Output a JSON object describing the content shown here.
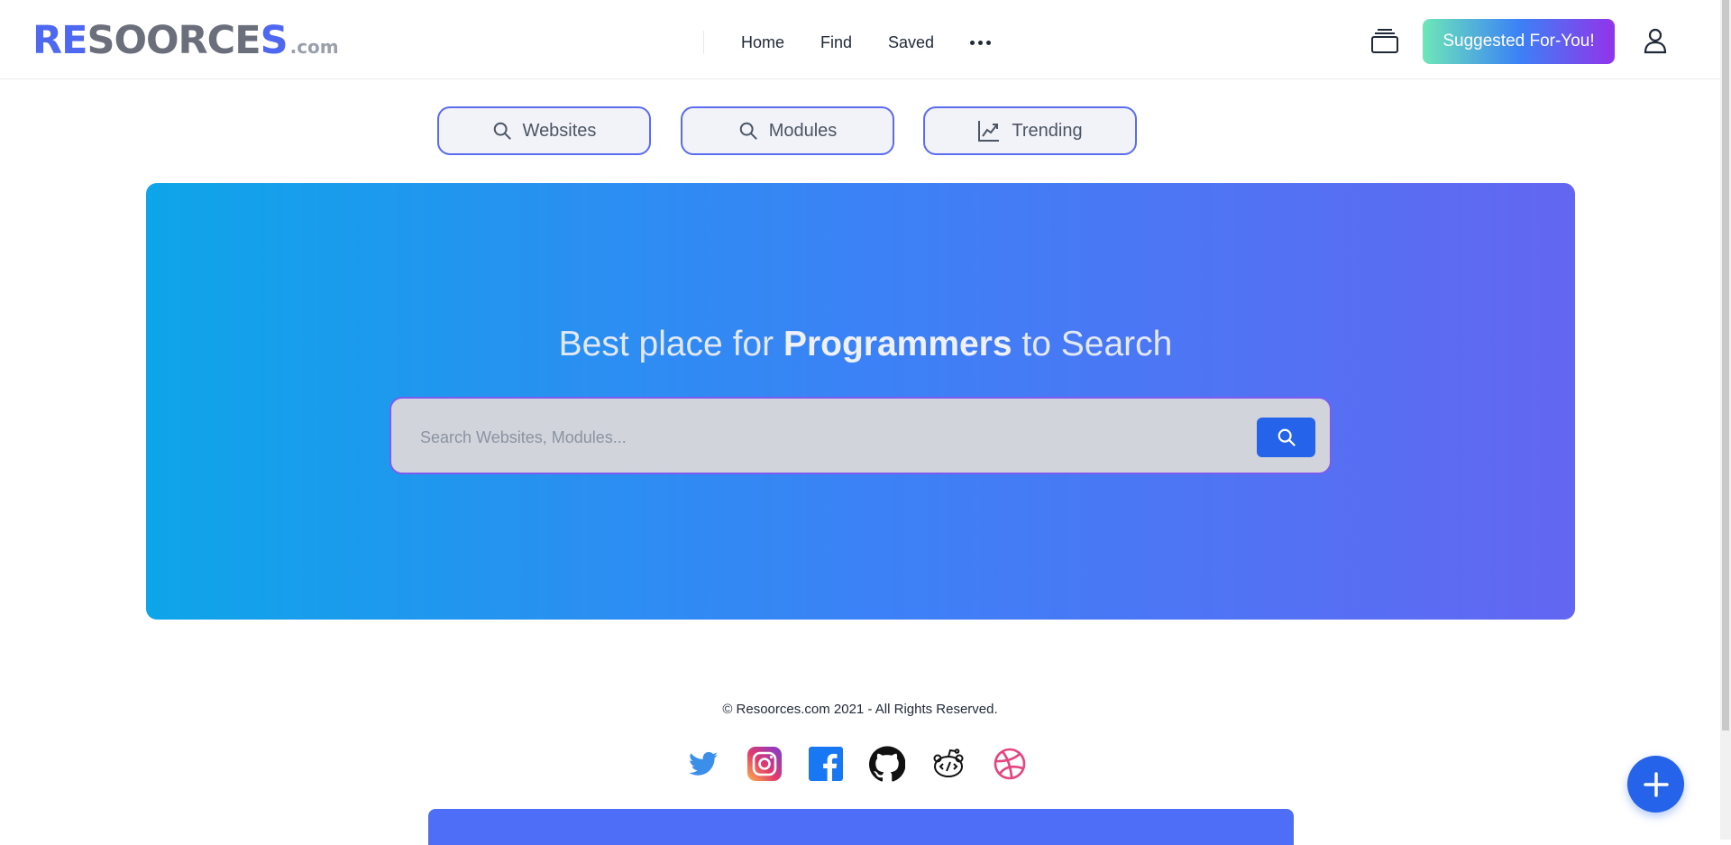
{
  "header": {
    "logo": {
      "part1": "RE",
      "part2": "SOORCE",
      "part3": "S",
      "tld": ".com"
    },
    "nav": {
      "home": "Home",
      "find": "Find",
      "saved": "Saved"
    },
    "more_icon": "more-horizontal-icon",
    "collections_icon": "stacked-cards-icon",
    "suggest_button": "Suggested For-You!",
    "user_icon": "user-icon"
  },
  "filters": [
    {
      "label": "Websites",
      "icon": "search-icon"
    },
    {
      "label": "Modules",
      "icon": "search-icon"
    },
    {
      "label": "Trending",
      "icon": "trending-chart-icon"
    }
  ],
  "hero": {
    "title_prefix": "Best place for ",
    "title_bold": "Programmers",
    "title_suffix": " to Search",
    "search_placeholder": "Search Websites, Modules...",
    "search_value": ""
  },
  "footer": {
    "copyright": "© Resoorces.com 2021 - All Rights Reserved.",
    "socials": [
      "twitter",
      "instagram",
      "facebook",
      "github",
      "reddit",
      "dribbble"
    ]
  },
  "colors": {
    "brand_blue": "#4f68f0",
    "primary": "#2563eb",
    "hero_gradient_start": "#0ea5e9",
    "hero_gradient_end": "#6366f1"
  }
}
